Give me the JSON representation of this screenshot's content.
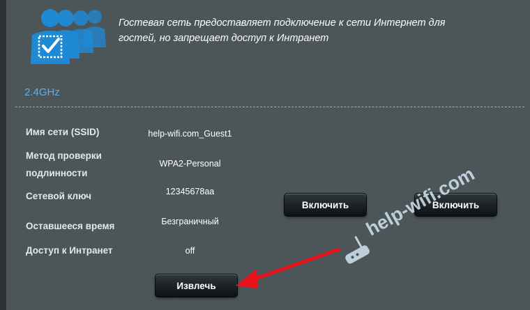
{
  "header": {
    "description_line1": "Гостевая сеть предоставляет подключение к сети Интернет для",
    "description_line2": "гостей, но запрещает доступ к Интранет"
  },
  "band": {
    "title": "2.4GHz"
  },
  "fields": {
    "ssid": {
      "label": "Имя сети (SSID)",
      "value": "help-wifi.com_Guest1"
    },
    "auth": {
      "label_line1": "Метод проверки",
      "label_line2": "подлинности",
      "value": "WPA2-Personal"
    },
    "key": {
      "label": "Сетевой ключ",
      "value": "12345678aa"
    },
    "time": {
      "label": "Оставшееся время",
      "value": "Безграничный"
    },
    "intranet": {
      "label": "Доступ к Интранет",
      "value": "off"
    }
  },
  "buttons": {
    "remove": "Извлечь",
    "enable_1": "Включить",
    "enable_2": "Включить"
  },
  "watermark": {
    "text": "help-wifi.com"
  },
  "colors": {
    "background": "#4c5558",
    "band_title": "#5fb0e6",
    "arrow": "#e8141c",
    "icon_blue": "#1e8ad6"
  }
}
